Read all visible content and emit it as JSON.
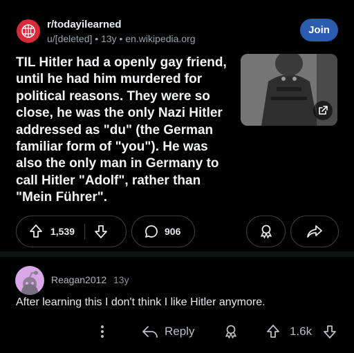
{
  "post": {
    "subreddit": "r/todayilearned",
    "author": "u/[deleted]",
    "age": "13y",
    "domain": "en.wikipedia.org",
    "join_label": "Join",
    "title": "TIL Hitler had a openly gay friend, until he had him murdered for political reasons. They were so close, he was the only Nazi Hitler addressed as \"du\" (the German familiar form of \"you\"). He was also the only man in Germany to call Hitler \"Adolf\", rather than \"Mein Führer\".",
    "vote_count": "1,539",
    "comment_count": "906"
  },
  "comment": {
    "user": "Reagan2012",
    "age": "13y",
    "body": "After learning this I don't think I like Hitler anymore.",
    "reply_label": "Reply",
    "vote_count": "1.6k"
  },
  "icons": [
    "reddit-brain-icon",
    "external-link-icon",
    "upvote-icon",
    "downvote-icon",
    "comment-icon",
    "award-icon",
    "share-icon",
    "snoo-avatar-icon",
    "more-icon",
    "reply-icon"
  ],
  "colors": {
    "join": "#2a5cb0",
    "subreddit_avatar": "#d82b3a",
    "comment_avatar": "#d9a7e6"
  }
}
